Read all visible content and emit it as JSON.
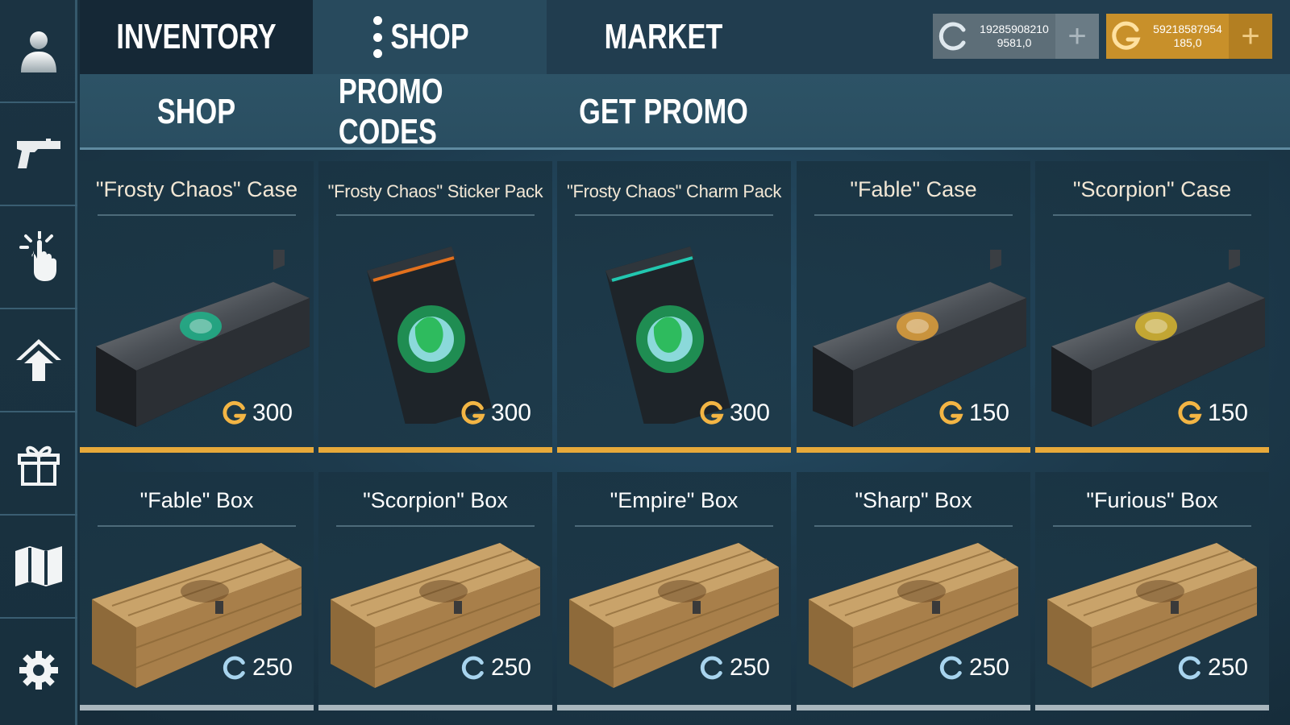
{
  "top_tabs": [
    {
      "label": "INVENTORY"
    },
    {
      "label": "SHOP"
    },
    {
      "label": "MARKET"
    }
  ],
  "currencies": {
    "silver": {
      "line1": "19285908210",
      "line2": "9581,0",
      "plus": "+"
    },
    "gold": {
      "line1": "59218587954",
      "line2": "185,0",
      "plus": "+"
    }
  },
  "sub_tabs": [
    {
      "label": "SHOP"
    },
    {
      "label": "PROMO CODES"
    },
    {
      "label": "GET PROMO"
    }
  ],
  "sidebar": {
    "items": [
      "profile-icon",
      "pistol-icon",
      "tap-hand-icon",
      "home-up-icon",
      "gift-icon",
      "map-icon",
      "gear-icon"
    ]
  },
  "row1": [
    {
      "title": "\"Frosty Chaos\" Case",
      "price": "300",
      "currency": "gold",
      "art": "metal-case",
      "emblem": "#1fb38a"
    },
    {
      "title": "\"Frosty Chaos\" Sticker Pack",
      "price": "300",
      "currency": "gold",
      "art": "pack",
      "emblem": "#e2701d"
    },
    {
      "title": "\"Frosty Chaos\" Charm Pack",
      "price": "300",
      "currency": "gold",
      "art": "pack",
      "emblem": "#22c7b0"
    },
    {
      "title": "\"Fable\" Case",
      "price": "150",
      "currency": "gold",
      "art": "metal-case",
      "emblem": "#e0a03a"
    },
    {
      "title": "\"Scorpion\" Case",
      "price": "150",
      "currency": "gold",
      "art": "metal-case",
      "emblem": "#d8b62e"
    }
  ],
  "row2": [
    {
      "title": "\"Fable\" Box",
      "price": "250",
      "currency": "silver"
    },
    {
      "title": "\"Scorpion\" Box",
      "price": "250",
      "currency": "silver"
    },
    {
      "title": "\"Empire\" Box",
      "price": "250",
      "currency": "silver"
    },
    {
      "title": "\"Sharp\" Box",
      "price": "250",
      "currency": "silver"
    },
    {
      "title": "\"Furious\" Box",
      "price": "250",
      "currency": "silver"
    }
  ],
  "colors": {
    "gold_accent": "#e7a93a",
    "silver_bar": "#a9b6bd",
    "gold_currency_bg": "#c8902a",
    "silver_currency_bg": "#5d6e78"
  }
}
